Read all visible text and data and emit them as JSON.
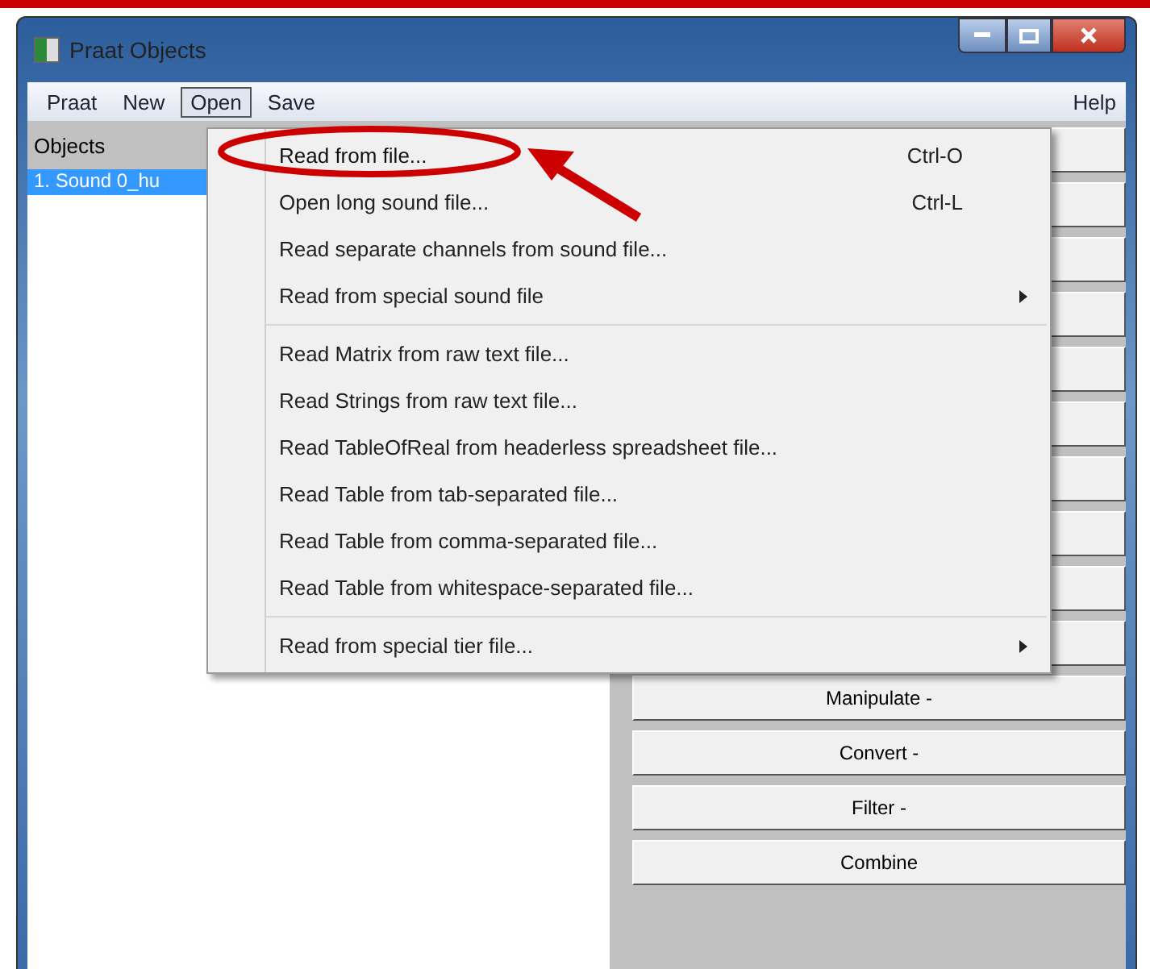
{
  "window": {
    "title": "Praat Objects"
  },
  "menu_bar": [
    {
      "label": "Praat",
      "selected": false
    },
    {
      "label": "New",
      "selected": false
    },
    {
      "label": "Open",
      "selected": true
    },
    {
      "label": "Save",
      "selected": false
    }
  ],
  "help_menu": {
    "label": "Help"
  },
  "objects": {
    "header": "Objects",
    "items": [
      {
        "label": "1. Sound 0_hu",
        "selected": true
      }
    ]
  },
  "buttons": [
    "Manipulate -",
    "Convert -",
    "Filter -",
    "Combine"
  ],
  "open_menu": {
    "groups": [
      [
        {
          "label": "Read from file...",
          "shortcut": "Ctrl-O",
          "submenu": false,
          "highlighted": true
        },
        {
          "label": "Open long sound file...",
          "shortcut": "Ctrl-L",
          "submenu": false,
          "highlighted": false
        },
        {
          "label": "Read separate channels from sound file...",
          "submenu": false,
          "highlighted": false
        },
        {
          "label": "Read from special sound file",
          "submenu": true,
          "highlighted": false
        }
      ],
      [
        {
          "label": "Read Matrix from raw text file...",
          "submenu": false,
          "highlighted": false
        },
        {
          "label": "Read Strings from raw text file...",
          "submenu": false,
          "highlighted": false
        },
        {
          "label": "Read TableOfReal from headerless spreadsheet file...",
          "submenu": false,
          "highlighted": false
        },
        {
          "label": "Read Table from tab-separated file...",
          "submenu": false,
          "highlighted": false
        },
        {
          "label": "Read Table from comma-separated file...",
          "submenu": false,
          "highlighted": false
        },
        {
          "label": "Read Table from whitespace-separated file...",
          "submenu": false,
          "highlighted": false
        }
      ],
      [
        {
          "label": "Read from special tier file...",
          "submenu": true,
          "highlighted": false
        }
      ]
    ]
  }
}
